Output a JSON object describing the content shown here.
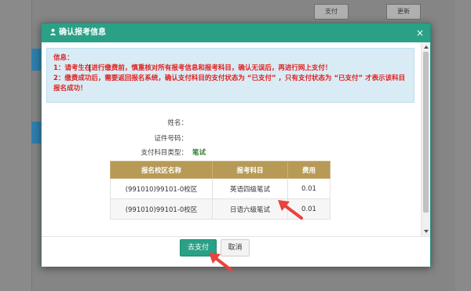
{
  "background": {
    "buttons": [
      "支付",
      "更新"
    ]
  },
  "dialog": {
    "title": "确认报考信息",
    "close_glyph": "×",
    "notice": {
      "heading": "信息：",
      "line1": "1：请考生在进行缴费前，慎重核对所有报考信息和报考科目，确认无误后，再进行网上支付！",
      "line2": "2：缴费成功后，需要返回报名系统，确认支付科目的支付状态为 “已支付” ，只有支付状态为 “已支付” 才表示该科目报名成功！"
    },
    "fields": {
      "name_label": "姓名：",
      "name_value": "",
      "id_label": "证件号码：",
      "id_value": "",
      "pay_type_label": "支付科目类型：",
      "pay_type_value": "笔试"
    },
    "table": {
      "headers": [
        "报名校区名称",
        "报考科目",
        "费用"
      ],
      "rows": [
        [
          "(991010)99101-0校区",
          "英语四级笔试",
          "0.01"
        ],
        [
          "(991010)99101-0校区",
          "日语六级笔试",
          "0.01"
        ]
      ]
    },
    "buttons": {
      "pay": "去支付",
      "cancel": "取消"
    }
  },
  "colors": {
    "header": "#2aa186",
    "notice_text": "#e02020",
    "table_header": "#b69a56",
    "annotation_arrow": "#e8433c"
  }
}
